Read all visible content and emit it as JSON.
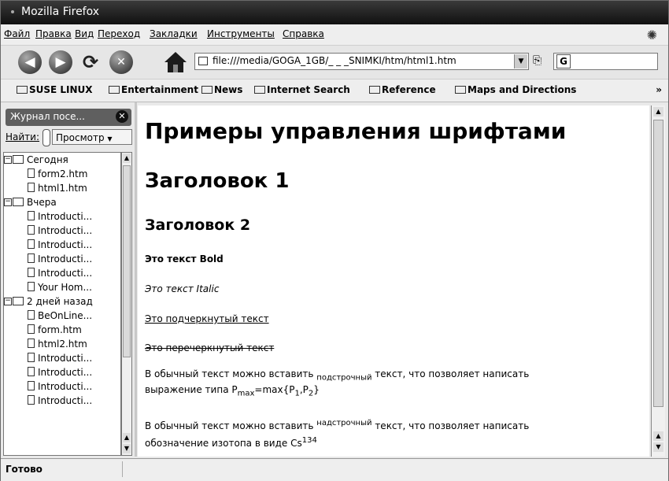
{
  "window": {
    "title": "Mozilla Firefox"
  },
  "menu": [
    "Файл",
    "Правка",
    "Вид",
    "Переход",
    "Закладки",
    "Инструменты",
    "Справка"
  ],
  "navigation": {
    "back_glyph": "◀",
    "forward_glyph": "▶",
    "reload_glyph": "⟳",
    "stop_glyph": "✕",
    "url": "file:///media/GOGA_1GB/_ _ _SNIMKI/htm/html1.htm",
    "search_engine_glyph": "G"
  },
  "bookmarks": [
    "SUSE LINUX",
    "Entertainment",
    "News",
    "Internet Search",
    "Reference",
    "Maps and Directions"
  ],
  "sidebar": {
    "title": "Журнал посе...",
    "find_label": "Найти:",
    "view_label": "Просмотр",
    "tree": [
      {
        "type": "folder",
        "label": "Сегодня"
      },
      {
        "type": "page",
        "label": "form2.htm"
      },
      {
        "type": "page",
        "label": "html1.htm"
      },
      {
        "type": "folder",
        "label": "Вчера"
      },
      {
        "type": "page",
        "label": "Introducti..."
      },
      {
        "type": "page",
        "label": "Introducti..."
      },
      {
        "type": "page",
        "label": "Introducti..."
      },
      {
        "type": "page",
        "label": "Introducti..."
      },
      {
        "type": "page",
        "label": "Introducti..."
      },
      {
        "type": "page",
        "label": "Your Hom..."
      },
      {
        "type": "folder",
        "label": "2 дней назад"
      },
      {
        "type": "page",
        "label": "BeOnLine..."
      },
      {
        "type": "page",
        "label": "form.htm"
      },
      {
        "type": "page",
        "label": "html2.htm"
      },
      {
        "type": "page",
        "label": "Introducti..."
      },
      {
        "type": "page",
        "label": "Introducti..."
      },
      {
        "type": "page",
        "label": "Introducti..."
      },
      {
        "type": "page",
        "label": "Introducti..."
      }
    ]
  },
  "page": {
    "title": "Примеры управления шрифтами",
    "heading1": "Заголовок 1",
    "heading2": "Заголовок 2",
    "bold_text": "Это текст Bold",
    "italic_text": "Это текст Italic",
    "underline_text": "Это подчеркнутый текст",
    "strike_text": "Это перечеркнутый текст",
    "sub_para": {
      "line1_start": "В обычный текст можно вставить ",
      "line1_sub": "подстрочный",
      "line1_end": " текст, что позволяет написать",
      "line2_start": "выражение типа P",
      "p_sub": "max",
      "line2_mid": "=max{P",
      "sub1": "1",
      "comma": ",P",
      "sub2": "2",
      "close": "}"
    },
    "sup_para": {
      "line1_start": "В обычный текст можно вставить ",
      "line1_sup": "надстрочный",
      "line1_end": " текст, что позволяет написать",
      "line2_start": "обозначение изотопа в виде Cs",
      "cs_sup": "134"
    }
  },
  "status": {
    "text": "Готово"
  }
}
